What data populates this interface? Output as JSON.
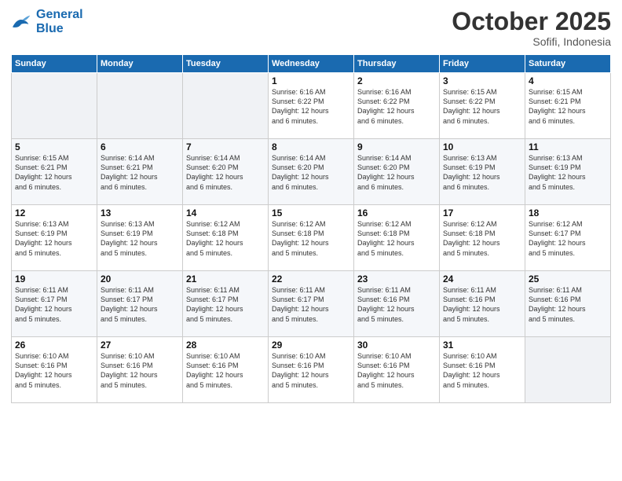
{
  "header": {
    "logo_line1": "General",
    "logo_line2": "Blue",
    "month": "October 2025",
    "location": "Sofifi, Indonesia"
  },
  "weekdays": [
    "Sunday",
    "Monday",
    "Tuesday",
    "Wednesday",
    "Thursday",
    "Friday",
    "Saturday"
  ],
  "weeks": [
    [
      {
        "day": "",
        "info": ""
      },
      {
        "day": "",
        "info": ""
      },
      {
        "day": "",
        "info": ""
      },
      {
        "day": "1",
        "info": "Sunrise: 6:16 AM\nSunset: 6:22 PM\nDaylight: 12 hours\nand 6 minutes."
      },
      {
        "day": "2",
        "info": "Sunrise: 6:16 AM\nSunset: 6:22 PM\nDaylight: 12 hours\nand 6 minutes."
      },
      {
        "day": "3",
        "info": "Sunrise: 6:15 AM\nSunset: 6:22 PM\nDaylight: 12 hours\nand 6 minutes."
      },
      {
        "day": "4",
        "info": "Sunrise: 6:15 AM\nSunset: 6:21 PM\nDaylight: 12 hours\nand 6 minutes."
      }
    ],
    [
      {
        "day": "5",
        "info": "Sunrise: 6:15 AM\nSunset: 6:21 PM\nDaylight: 12 hours\nand 6 minutes."
      },
      {
        "day": "6",
        "info": "Sunrise: 6:14 AM\nSunset: 6:21 PM\nDaylight: 12 hours\nand 6 minutes."
      },
      {
        "day": "7",
        "info": "Sunrise: 6:14 AM\nSunset: 6:20 PM\nDaylight: 12 hours\nand 6 minutes."
      },
      {
        "day": "8",
        "info": "Sunrise: 6:14 AM\nSunset: 6:20 PM\nDaylight: 12 hours\nand 6 minutes."
      },
      {
        "day": "9",
        "info": "Sunrise: 6:14 AM\nSunset: 6:20 PM\nDaylight: 12 hours\nand 6 minutes."
      },
      {
        "day": "10",
        "info": "Sunrise: 6:13 AM\nSunset: 6:19 PM\nDaylight: 12 hours\nand 6 minutes."
      },
      {
        "day": "11",
        "info": "Sunrise: 6:13 AM\nSunset: 6:19 PM\nDaylight: 12 hours\nand 5 minutes."
      }
    ],
    [
      {
        "day": "12",
        "info": "Sunrise: 6:13 AM\nSunset: 6:19 PM\nDaylight: 12 hours\nand 5 minutes."
      },
      {
        "day": "13",
        "info": "Sunrise: 6:13 AM\nSunset: 6:19 PM\nDaylight: 12 hours\nand 5 minutes."
      },
      {
        "day": "14",
        "info": "Sunrise: 6:12 AM\nSunset: 6:18 PM\nDaylight: 12 hours\nand 5 minutes."
      },
      {
        "day": "15",
        "info": "Sunrise: 6:12 AM\nSunset: 6:18 PM\nDaylight: 12 hours\nand 5 minutes."
      },
      {
        "day": "16",
        "info": "Sunrise: 6:12 AM\nSunset: 6:18 PM\nDaylight: 12 hours\nand 5 minutes."
      },
      {
        "day": "17",
        "info": "Sunrise: 6:12 AM\nSunset: 6:18 PM\nDaylight: 12 hours\nand 5 minutes."
      },
      {
        "day": "18",
        "info": "Sunrise: 6:12 AM\nSunset: 6:17 PM\nDaylight: 12 hours\nand 5 minutes."
      }
    ],
    [
      {
        "day": "19",
        "info": "Sunrise: 6:11 AM\nSunset: 6:17 PM\nDaylight: 12 hours\nand 5 minutes."
      },
      {
        "day": "20",
        "info": "Sunrise: 6:11 AM\nSunset: 6:17 PM\nDaylight: 12 hours\nand 5 minutes."
      },
      {
        "day": "21",
        "info": "Sunrise: 6:11 AM\nSunset: 6:17 PM\nDaylight: 12 hours\nand 5 minutes."
      },
      {
        "day": "22",
        "info": "Sunrise: 6:11 AM\nSunset: 6:17 PM\nDaylight: 12 hours\nand 5 minutes."
      },
      {
        "day": "23",
        "info": "Sunrise: 6:11 AM\nSunset: 6:16 PM\nDaylight: 12 hours\nand 5 minutes."
      },
      {
        "day": "24",
        "info": "Sunrise: 6:11 AM\nSunset: 6:16 PM\nDaylight: 12 hours\nand 5 minutes."
      },
      {
        "day": "25",
        "info": "Sunrise: 6:11 AM\nSunset: 6:16 PM\nDaylight: 12 hours\nand 5 minutes."
      }
    ],
    [
      {
        "day": "26",
        "info": "Sunrise: 6:10 AM\nSunset: 6:16 PM\nDaylight: 12 hours\nand 5 minutes."
      },
      {
        "day": "27",
        "info": "Sunrise: 6:10 AM\nSunset: 6:16 PM\nDaylight: 12 hours\nand 5 minutes."
      },
      {
        "day": "28",
        "info": "Sunrise: 6:10 AM\nSunset: 6:16 PM\nDaylight: 12 hours\nand 5 minutes."
      },
      {
        "day": "29",
        "info": "Sunrise: 6:10 AM\nSunset: 6:16 PM\nDaylight: 12 hours\nand 5 minutes."
      },
      {
        "day": "30",
        "info": "Sunrise: 6:10 AM\nSunset: 6:16 PM\nDaylight: 12 hours\nand 5 minutes."
      },
      {
        "day": "31",
        "info": "Sunrise: 6:10 AM\nSunset: 6:16 PM\nDaylight: 12 hours\nand 5 minutes."
      },
      {
        "day": "",
        "info": ""
      }
    ]
  ]
}
